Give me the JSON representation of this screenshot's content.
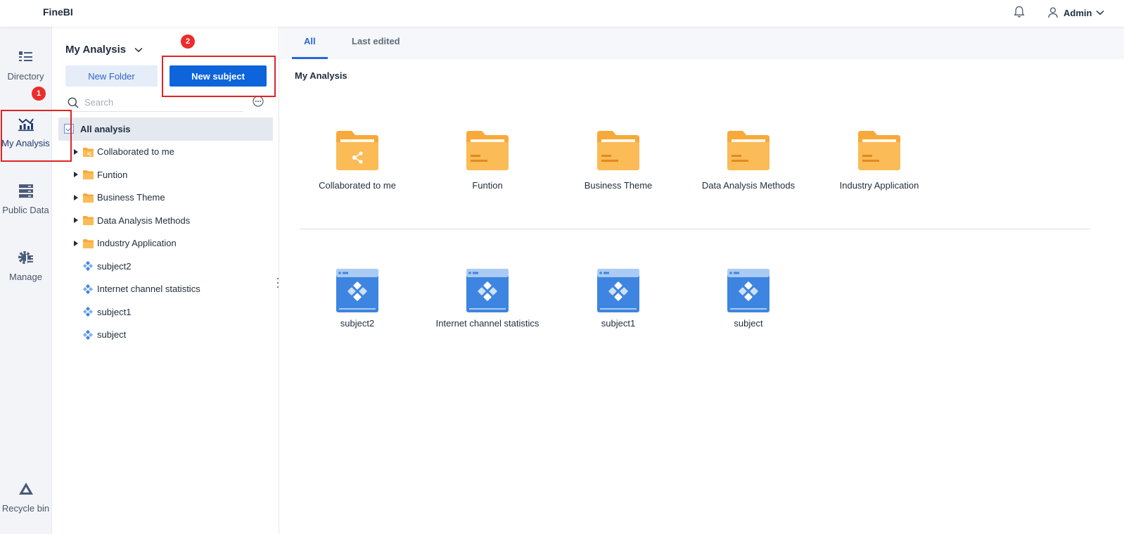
{
  "app": {
    "title": "FineBI"
  },
  "header": {
    "user_name": "Admin"
  },
  "rail": {
    "items": [
      {
        "label": "Directory"
      },
      {
        "label": "My Analysis"
      },
      {
        "label": "Public Data"
      },
      {
        "label": "Manage"
      },
      {
        "label": "Recycle bin"
      }
    ]
  },
  "annotations": {
    "badge1": "1",
    "badge2": "2"
  },
  "panel": {
    "title": "My Analysis",
    "new_folder_label": "New Folder",
    "new_subject_label": "New subject",
    "search_placeholder": "Search",
    "tree": [
      {
        "label": "All analysis",
        "type": "root"
      },
      {
        "label": "Collaborated to me",
        "type": "shared-folder"
      },
      {
        "label": "Funtion",
        "type": "folder"
      },
      {
        "label": "Business Theme",
        "type": "folder"
      },
      {
        "label": "Data Analysis Methods",
        "type": "folder"
      },
      {
        "label": "Industry Application",
        "type": "folder"
      },
      {
        "label": "subject2",
        "type": "subject"
      },
      {
        "label": "Internet channel statistics",
        "type": "subject"
      },
      {
        "label": "subject1",
        "type": "subject"
      },
      {
        "label": "subject",
        "type": "subject"
      }
    ]
  },
  "main": {
    "tabs": [
      {
        "label": "All"
      },
      {
        "label": "Last edited"
      }
    ],
    "section_title": "My Analysis",
    "folders": [
      {
        "label": "Collaborated to me",
        "icon": "shared-folder-icon"
      },
      {
        "label": "Funtion",
        "icon": "folder-icon"
      },
      {
        "label": "Business Theme",
        "icon": "folder-icon"
      },
      {
        "label": "Data Analysis Methods",
        "icon": "folder-icon"
      },
      {
        "label": "Industry Application",
        "icon": "folder-icon"
      }
    ],
    "subjects": [
      {
        "label": "subject2",
        "icon": "subject-icon"
      },
      {
        "label": "Internet channel statistics",
        "icon": "subject-icon"
      },
      {
        "label": "subject1",
        "icon": "subject-icon"
      },
      {
        "label": "subject",
        "icon": "subject-icon"
      }
    ]
  },
  "colors": {
    "accent": "#0d64db",
    "folder": "#fbb03b",
    "subject": "#3d85e0",
    "annotation": "#e02424"
  }
}
